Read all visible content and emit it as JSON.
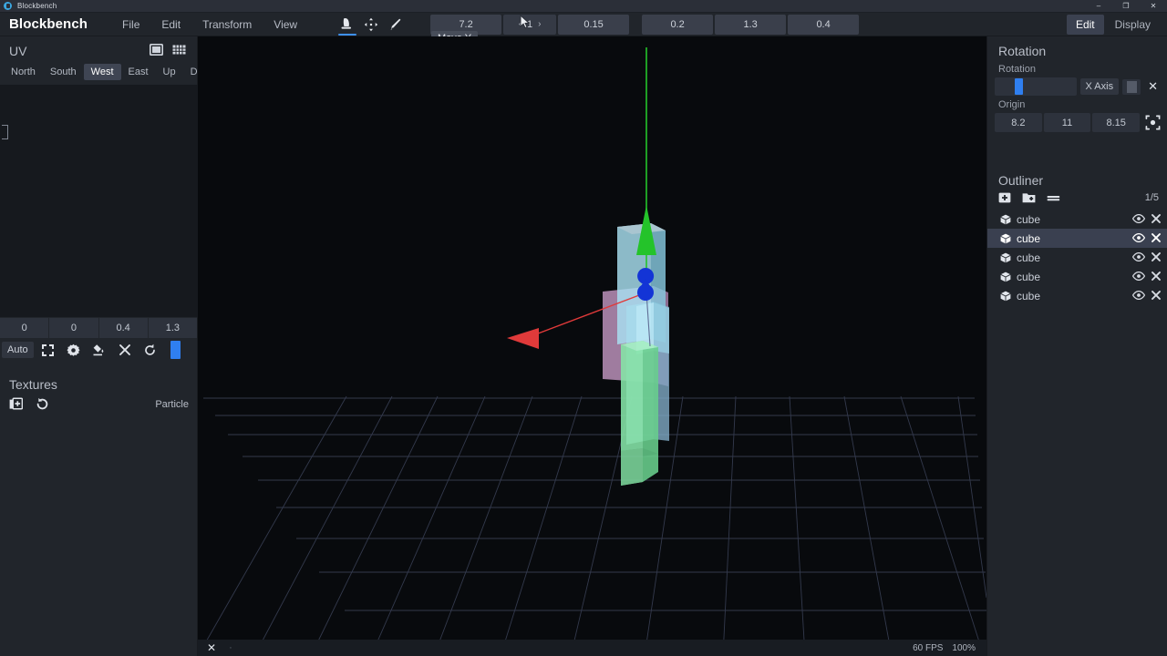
{
  "os_titlebar": {
    "app_name": "Blockbench",
    "minimize": "–",
    "maximize": "❐",
    "close": "✕"
  },
  "menubar": {
    "brand": "Blockbench",
    "items": [
      {
        "label": "File"
      },
      {
        "label": "Edit"
      },
      {
        "label": "Transform"
      },
      {
        "label": "View"
      }
    ],
    "mode_icons": [
      {
        "name": "select-tool-icon",
        "active": true
      },
      {
        "name": "move-tool-icon",
        "active": false
      },
      {
        "name": "brush-tool-icon",
        "active": false
      }
    ],
    "fields": [
      {
        "name": "field-1",
        "value": "7.2"
      },
      {
        "name": "stepper-frame",
        "value": "1"
      },
      {
        "name": "field-2",
        "value": "0.15"
      },
      {
        "name": "field-3",
        "value": "0.2"
      },
      {
        "name": "field-4",
        "value": "1.3"
      },
      {
        "name": "field-5",
        "value": "0.4"
      }
    ],
    "stepper_prev": "‹",
    "stepper_next": "›",
    "tooltip": "Move Y",
    "mode_tabs": [
      {
        "label": "Edit",
        "active": true
      },
      {
        "label": "Display",
        "active": false
      }
    ]
  },
  "uv_panel": {
    "title": "UV",
    "header_icons": [
      {
        "name": "uv-frame-icon"
      },
      {
        "name": "uv-grid-icon"
      }
    ],
    "faces": [
      {
        "label": "North",
        "active": false
      },
      {
        "label": "South",
        "active": false
      },
      {
        "label": "West",
        "active": true
      },
      {
        "label": "East",
        "active": false
      },
      {
        "label": "Up",
        "active": false
      },
      {
        "label": "Down",
        "active": false
      }
    ],
    "uv_values": [
      "0",
      "0",
      "0.4",
      "1.3"
    ],
    "auto_label": "Auto",
    "tools": [
      {
        "name": "fit-uv-icon"
      },
      {
        "name": "gear-icon"
      },
      {
        "name": "paint-bucket-icon"
      },
      {
        "name": "clear-uv-icon"
      },
      {
        "name": "rotate-uv-icon"
      }
    ],
    "swatch_color": "#2f7ff0"
  },
  "textures_panel": {
    "title": "Textures",
    "tools": [
      {
        "name": "add-texture-icon"
      },
      {
        "name": "reload-textures-icon"
      }
    ],
    "particle_label": "Particle"
  },
  "viewport": {
    "status": {
      "close_label": "✕",
      "dot_label": "·",
      "fps": "60 FPS",
      "zoom": "100%"
    },
    "gizmo": {
      "y_axis_color": "#24c32a",
      "x_axis_color": "#e03a3a",
      "z_handle_color": "#1334d6"
    },
    "grid_color": "#3a4156",
    "background": "#080a0d",
    "cubes": [
      {
        "name": "cube-cyan-upper",
        "color": "#7fd2ea"
      },
      {
        "name": "cube-pink-mid",
        "color": "#d9a8d8"
      },
      {
        "name": "cube-green-lower",
        "color": "#63dd92"
      },
      {
        "name": "cube-blue-right",
        "color": "#7fb3d4"
      },
      {
        "name": "cube-pale-front",
        "color": "#a8e4f5"
      }
    ]
  },
  "rotation_panel": {
    "title": "Rotation",
    "subtitle": "Rotation",
    "axis_label": "X Axis",
    "clear_label": "✕",
    "origin_label": "Origin",
    "origin_values": [
      "8.2",
      "11",
      "8.15"
    ],
    "pivot_icon": "pivot-target-icon"
  },
  "outliner": {
    "title": "Outliner",
    "toolbar_icons": [
      {
        "name": "add-cube-icon"
      },
      {
        "name": "add-group-icon"
      },
      {
        "name": "collapse-all-icon"
      }
    ],
    "counter": "1/5",
    "items": [
      {
        "label": "cube",
        "selected": false
      },
      {
        "label": "cube",
        "selected": true
      },
      {
        "label": "cube",
        "selected": false
      },
      {
        "label": "cube",
        "selected": false
      },
      {
        "label": "cube",
        "selected": false
      }
    ],
    "eye_icon": "visibility-eye-icon",
    "remove_icon": "remove-x-icon"
  }
}
